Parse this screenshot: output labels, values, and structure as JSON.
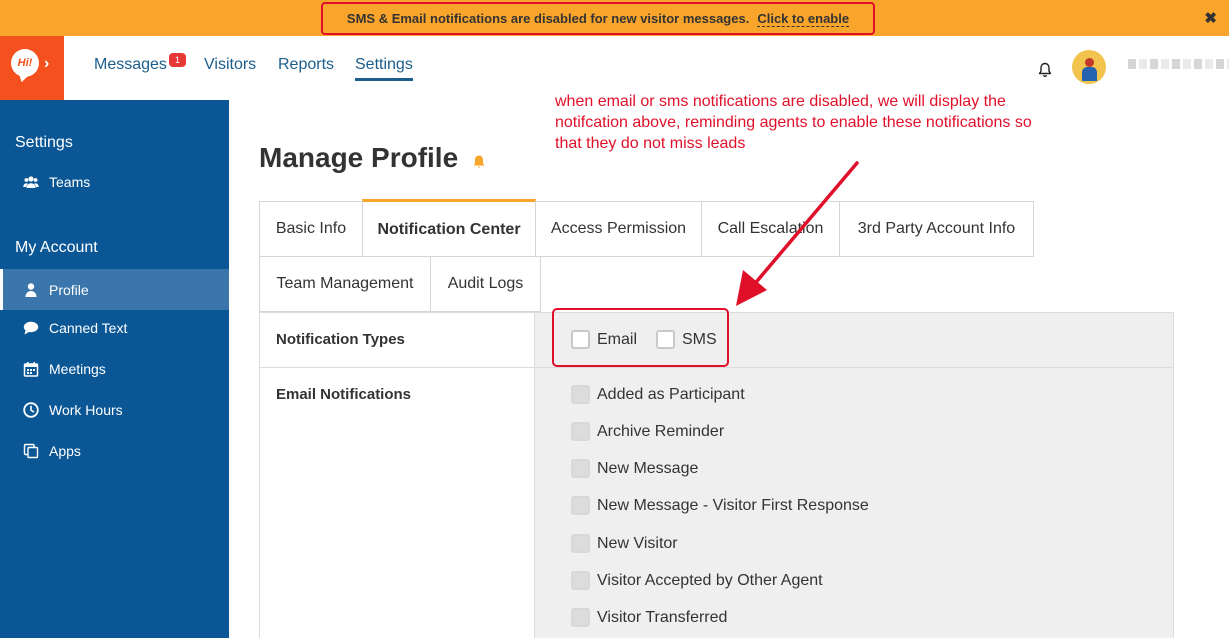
{
  "banner": {
    "message": "SMS & Email notifications are disabled for new visitor messages.",
    "link_text": "Click to enable",
    "close_glyph": "✖"
  },
  "topnav": {
    "logo_text": "Hi!",
    "items": [
      {
        "label": "Messages",
        "badge": "1"
      },
      {
        "label": "Visitors"
      },
      {
        "label": "Reports"
      },
      {
        "label": "Settings",
        "active": true
      }
    ]
  },
  "sidebar": {
    "sections": [
      {
        "heading": "Settings",
        "items": [
          {
            "label": "Teams",
            "icon": "users-icon"
          }
        ]
      },
      {
        "heading": "My Account",
        "items": [
          {
            "label": "Profile",
            "icon": "user-icon",
            "active": true
          },
          {
            "label": "Canned Text",
            "icon": "comment-icon"
          },
          {
            "label": "Meetings",
            "icon": "calendar-icon"
          },
          {
            "label": "Work Hours",
            "icon": "clock-icon"
          },
          {
            "label": "Apps",
            "icon": "copy-icon"
          }
        ]
      }
    ]
  },
  "main": {
    "title": "Manage Profile",
    "annotation": "when email or sms notifications are disabled, we will display the notifcation above, reminding agents to enable these notifications so that they do not miss leads",
    "tabs": [
      {
        "label": "Basic Info"
      },
      {
        "label": "Notification Center",
        "active": true
      },
      {
        "label": "Access Permission"
      },
      {
        "label": "Call Escalation"
      },
      {
        "label": "3rd Party Account Info"
      },
      {
        "label": "Team Management"
      },
      {
        "label": "Audit Logs"
      }
    ],
    "notification_types": {
      "label": "Notification Types",
      "options": [
        {
          "label": "Email",
          "checked": false
        },
        {
          "label": "SMS",
          "checked": false
        }
      ]
    },
    "email_notifications": {
      "label": "Email Notifications",
      "options": [
        {
          "label": "Added as Participant"
        },
        {
          "label": "Archive Reminder"
        },
        {
          "label": "New Message"
        },
        {
          "label": "New Message - Visitor First Response"
        },
        {
          "label": "New Visitor"
        },
        {
          "label": "Visitor Accepted by Other Agent"
        },
        {
          "label": "Visitor Transferred"
        }
      ]
    }
  },
  "colors": {
    "banner_bg": "#f9a52c",
    "highlight_red": "#e0102a",
    "brand_orange": "#f4511e",
    "sidebar_blue": "#0b5796",
    "nav_blue": "#1b5e8c"
  }
}
